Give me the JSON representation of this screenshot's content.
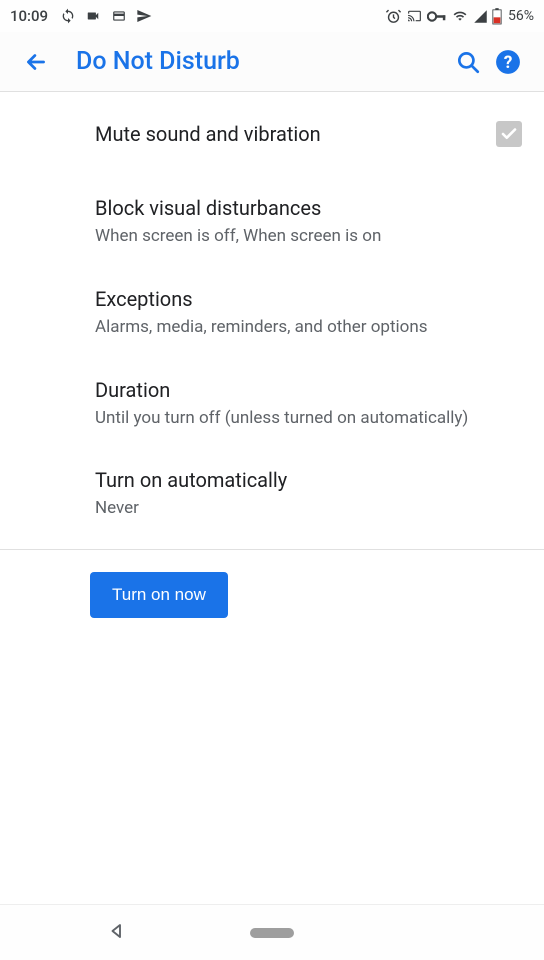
{
  "status": {
    "time": "10:09",
    "battery_pct": "56%"
  },
  "appbar": {
    "title": "Do Not Disturb"
  },
  "items": {
    "mute": {
      "title": "Mute sound and vibration"
    },
    "block": {
      "title": "Block visual disturbances",
      "sub": "When screen is off, When screen is on"
    },
    "exceptions": {
      "title": "Exceptions",
      "sub": "Alarms, media, reminders, and other options"
    },
    "duration": {
      "title": "Duration",
      "sub": "Until you turn off (unless turned on automatically)"
    },
    "auto": {
      "title": "Turn on automatically",
      "sub": "Never"
    }
  },
  "action": {
    "turn_on": "Turn on now"
  }
}
